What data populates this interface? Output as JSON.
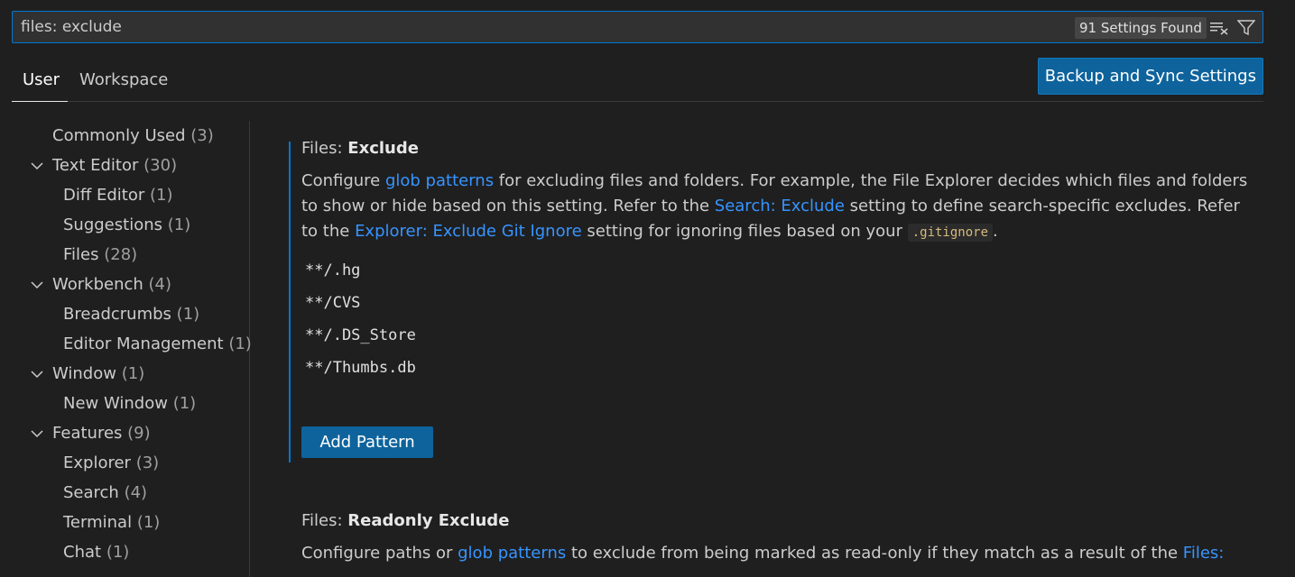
{
  "search": {
    "value": "files: exclude",
    "count_label": "91 Settings Found",
    "clear_icon": "clear-filter-icon",
    "filter_icon": "filter-icon"
  },
  "tabs": {
    "user": "User",
    "workspace": "Workspace"
  },
  "sync_button": "Backup and Sync Settings",
  "toc": {
    "commonly_used": {
      "label": "Commonly Used",
      "count": "(3)"
    },
    "text_editor": {
      "label": "Text Editor",
      "count": "(30)"
    },
    "diff_editor": {
      "label": "Diff Editor",
      "count": "(1)"
    },
    "suggestions": {
      "label": "Suggestions",
      "count": "(1)"
    },
    "files": {
      "label": "Files",
      "count": "(28)"
    },
    "workbench": {
      "label": "Workbench",
      "count": "(4)"
    },
    "breadcrumbs": {
      "label": "Breadcrumbs",
      "count": "(1)"
    },
    "editor_management": {
      "label": "Editor Management",
      "count": "(1)"
    },
    "window": {
      "label": "Window",
      "count": "(1)"
    },
    "new_window": {
      "label": "New Window",
      "count": "(1)"
    },
    "features": {
      "label": "Features",
      "count": "(9)"
    },
    "explorer": {
      "label": "Explorer",
      "count": "(3)"
    },
    "search": {
      "label": "Search",
      "count": "(4)"
    },
    "terminal": {
      "label": "Terminal",
      "count": "(1)"
    },
    "chat": {
      "label": "Chat",
      "count": "(1)"
    }
  },
  "setting1": {
    "category": "Files: ",
    "name": "Exclude",
    "desc": {
      "t1": "Configure ",
      "l1": "glob patterns",
      "t2": " for excluding files and folders. For example, the File Explorer decides which files and folders to show or hide based on this setting. Refer to the ",
      "l2": "Search: Exclude",
      "t3": " setting to define search-specific excludes. Refer to the ",
      "l3": "Explorer: Exclude Git Ignore",
      "t4": " setting for ignoring files based on your ",
      "code": ".gitignore",
      "t5": "."
    },
    "patterns": [
      "**/.hg",
      "**/CVS",
      "**/.DS_Store",
      "**/Thumbs.db"
    ],
    "add_button": "Add Pattern"
  },
  "setting2": {
    "category": "Files: ",
    "name": "Readonly Exclude",
    "desc": {
      "t1": "Configure paths or ",
      "l1": "glob patterns",
      "t2": " to exclude from being marked as read-only if they match as a result of the ",
      "l2": "Files:"
    }
  }
}
